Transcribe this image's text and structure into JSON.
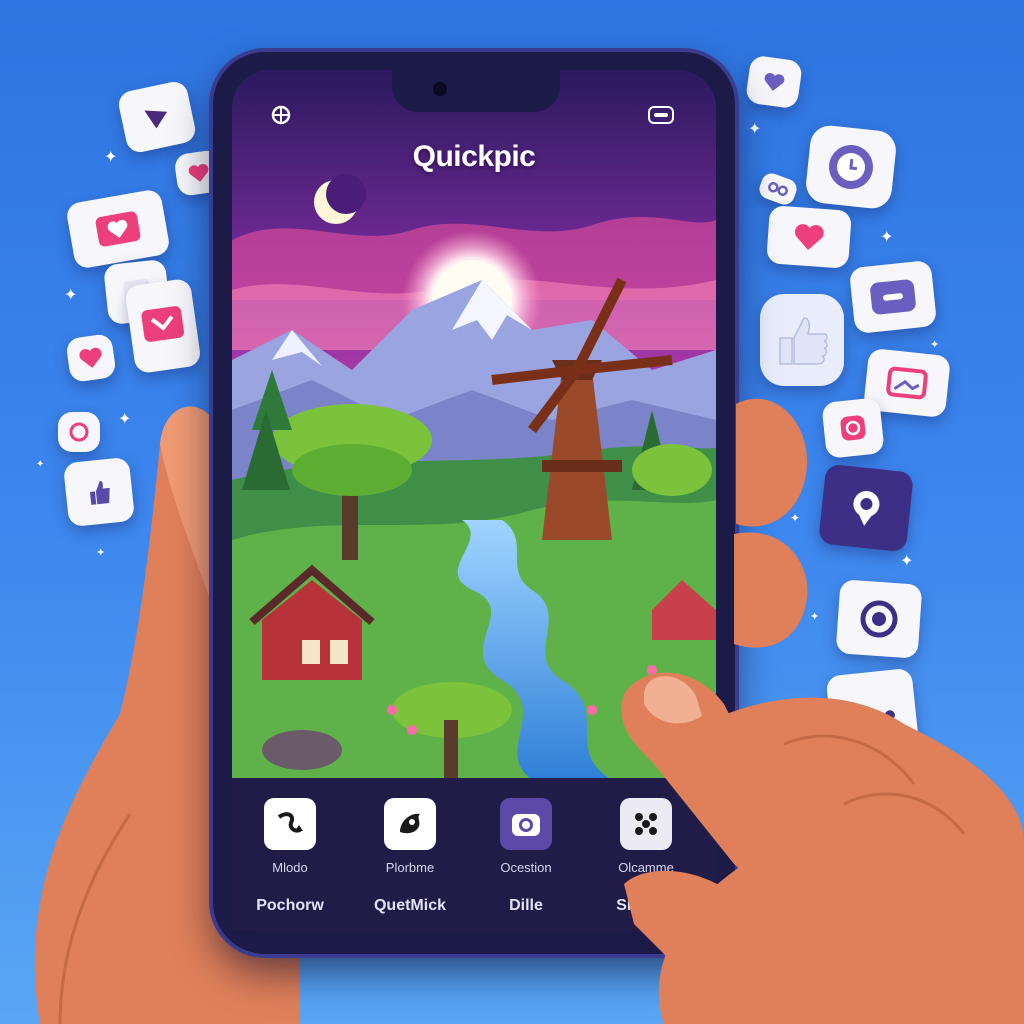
{
  "app": {
    "title": "Quickpic"
  },
  "dock": [
    {
      "caption": "Mlodo",
      "label": "Pochorw",
      "icon": "curved-arrow-icon"
    },
    {
      "caption": "Plorbme",
      "label": "QuetMick",
      "icon": "bird-icon"
    },
    {
      "caption": "Ocestion",
      "label": "Dille",
      "icon": "camera-icon"
    },
    {
      "caption": "Olcamme",
      "label": "Shoouo",
      "icon": "dice-icon"
    }
  ],
  "floating_icons": [
    "play-icon",
    "heart-chat-icon",
    "heart-chat-icon",
    "heart-icon",
    "chat-heart-icon",
    "heart-icon",
    "refresh-icon",
    "thumbs-up-icon",
    "heart-chat-icon",
    "clock-icon",
    "link-icon",
    "heart-chat-icon",
    "minus-icon",
    "thumbs-up-hand-icon",
    "image-icon",
    "instagram-icon",
    "location-icon",
    "record-icon",
    "share-icon"
  ],
  "colors": {
    "accent": "#6a3fb5",
    "heart": "#ec3f7c",
    "background": "#3c86ee"
  }
}
